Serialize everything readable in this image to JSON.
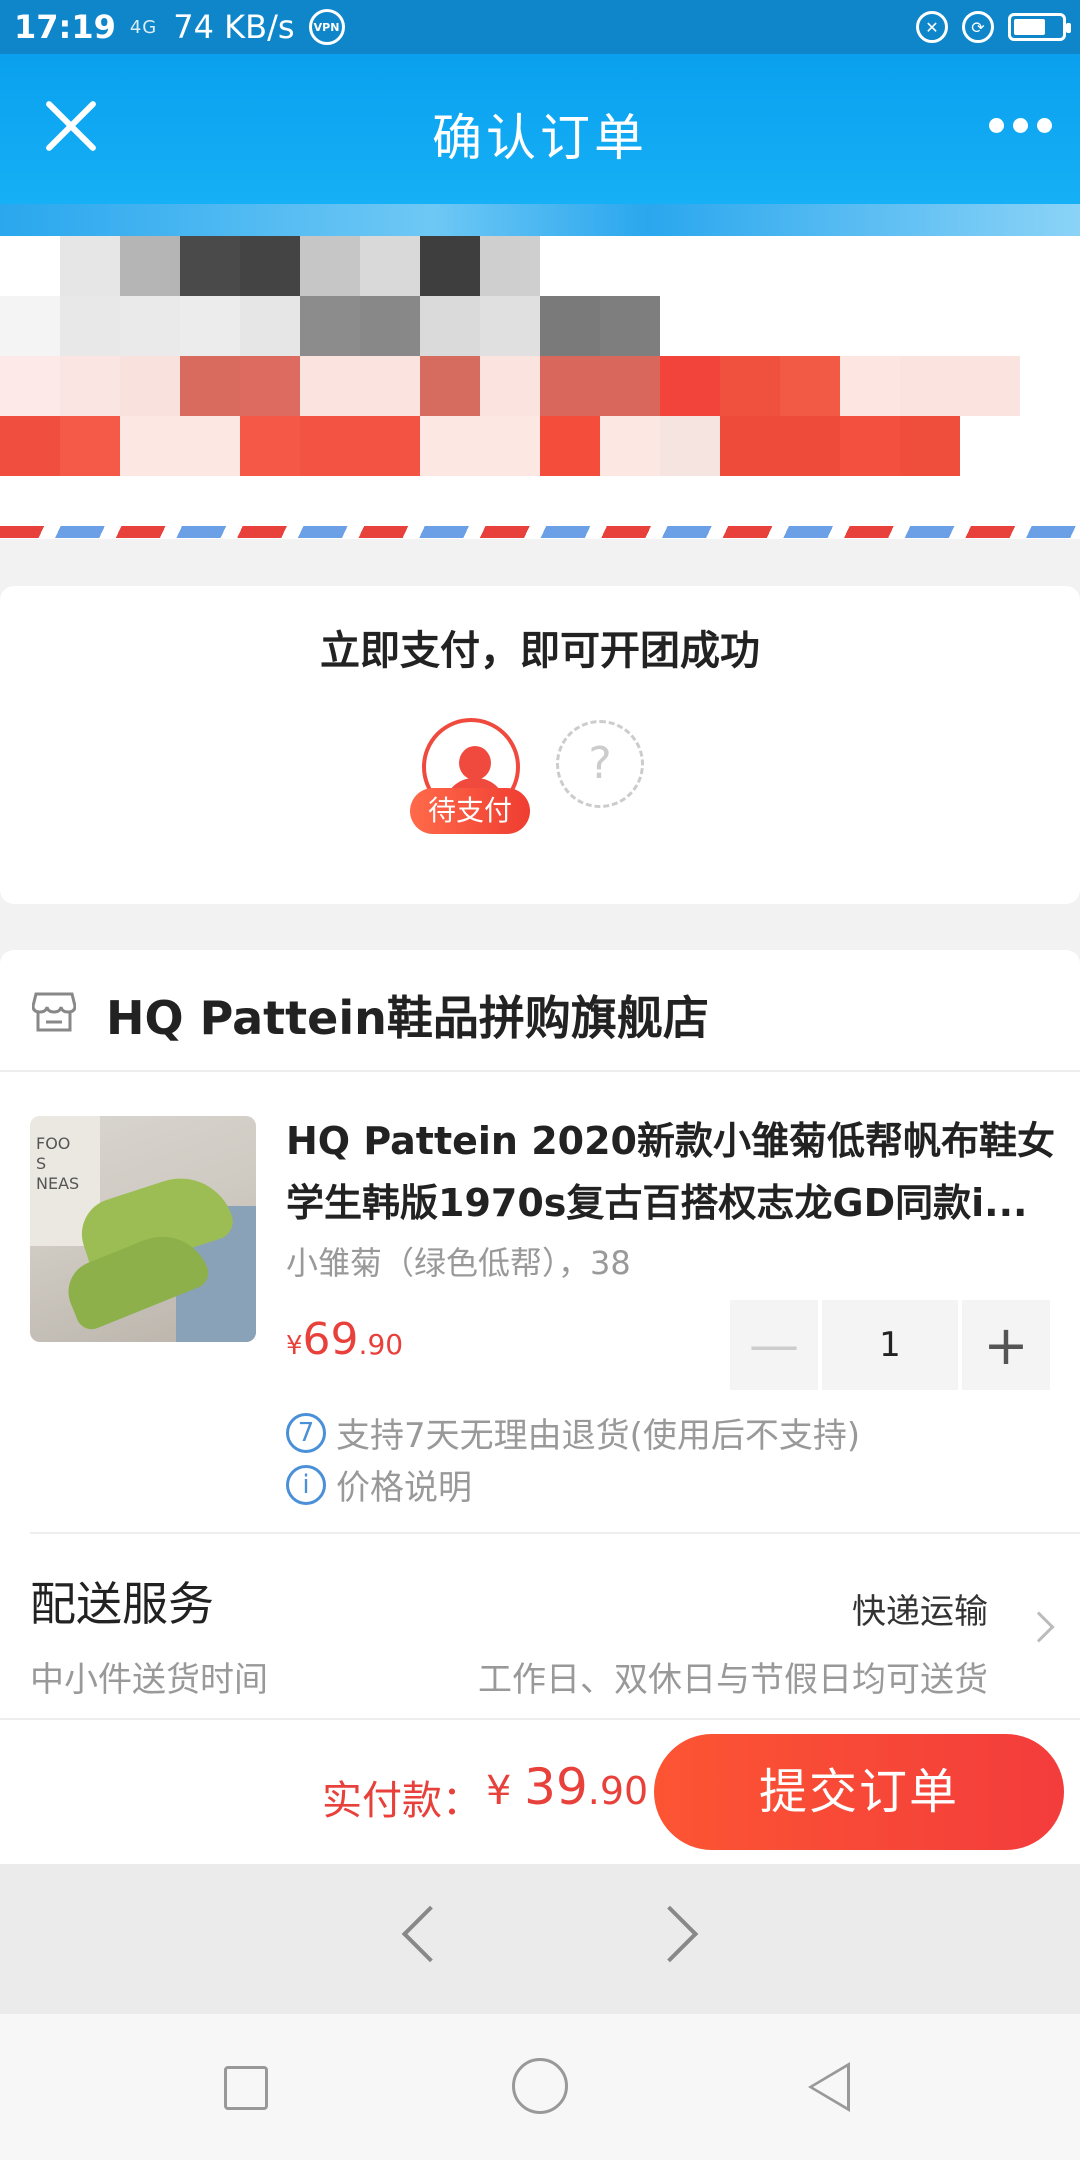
{
  "status_bar": {
    "time": "17:19",
    "signal": "4G",
    "network_speed": "74 KB/s",
    "vpn": "VPN",
    "icons": [
      "mute-icon",
      "lock-rotation-icon",
      "battery-icon"
    ]
  },
  "header": {
    "title": "确认订单",
    "close_icon": "close-icon",
    "more_icon": "more-icon"
  },
  "group_buy": {
    "title": "立即支付，即可开团成功",
    "pending_label": "待支付",
    "empty_slot": "?"
  },
  "store": {
    "name": "HQ Pattein鞋品拼购旗舰店",
    "icon": "store-icon"
  },
  "product": {
    "title_line1": "HQ Pattein 2020新款小雏菊低帮帆布鞋女",
    "title_line2": "学生韩版1970s复古百搭权志龙GD同款i...",
    "sku": "小雏菊（绿色低帮），38",
    "price_symbol": "¥",
    "price_int": "69",
    "price_dec": ".90",
    "quantity": "1",
    "minus": "—",
    "plus": "+",
    "return_policy": "支持7天无理由退货(使用后不支持)",
    "return_icon_text": "7",
    "price_note": "价格说明",
    "price_note_icon_text": "i",
    "image_text": "FOO\nS\nNEAS"
  },
  "delivery": {
    "title": "配送服务",
    "subtitle": "中小件送货时间",
    "type": "快递运输",
    "note": "工作日、双休日与节假日均可送货"
  },
  "footer": {
    "pay_label": "实付款：",
    "pay_symbol": "¥ ",
    "pay_int": "39",
    "pay_dec": ".90",
    "submit": "提交订单"
  },
  "colors": {
    "header_blue": "#0aa0ef",
    "accent_red": "#e8413b",
    "button_red": "#f33c3c"
  }
}
